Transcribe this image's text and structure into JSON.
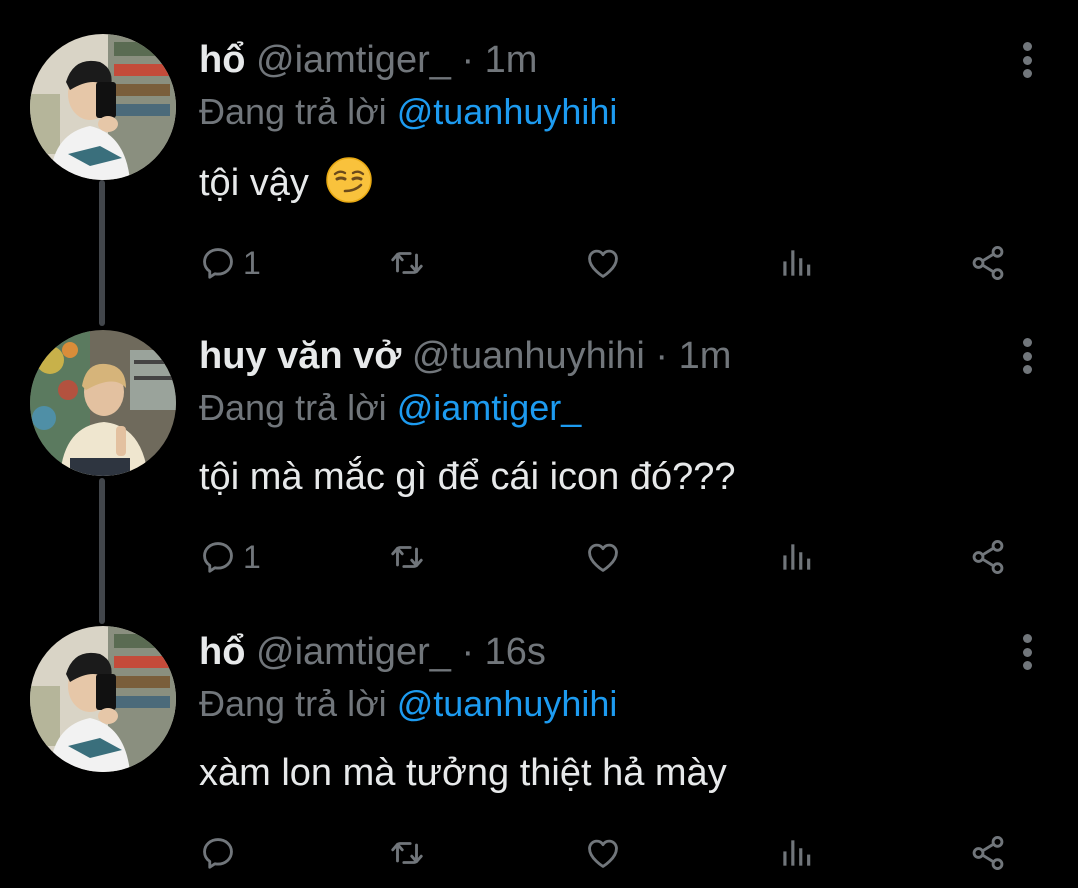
{
  "tweets": [
    {
      "name": "hổ",
      "handle": "@iamtiger_",
      "separator": "·",
      "time": "1m",
      "reply_prefix": "Đang trả lời",
      "reply_to": "@tuanhuyhihi",
      "text": "tội vậy",
      "emoji_icon": "smirking-face-emoji",
      "reply_count": "1",
      "retweet_count": "",
      "like_count": ""
    },
    {
      "name": "huy văn vở",
      "handle": "@tuanhuyhihi",
      "separator": "·",
      "time": "1m",
      "reply_prefix": "Đang trả lời",
      "reply_to": "@iamtiger_",
      "text": "tội mà mắc gì để cái icon đó???",
      "reply_count": "1",
      "retweet_count": "",
      "like_count": ""
    },
    {
      "name": "hổ",
      "handle": "@iamtiger_",
      "separator": "·",
      "time": "16s",
      "reply_prefix": "Đang trả lời",
      "reply_to": "@tuanhuyhihi",
      "text": "xàm lon mà tưởng thiệt hả mày",
      "reply_count": "",
      "retweet_count": "",
      "like_count": ""
    }
  ],
  "icons": {
    "reply": "reply-icon",
    "retweet": "retweet-icon",
    "like": "heart-icon",
    "views": "views-icon",
    "share": "share-icon",
    "more": "more-vertical-icon"
  },
  "colors": {
    "background": "#000000",
    "text": "#e7e9ea",
    "muted": "#71767b",
    "link": "#1d9bf0",
    "thread_line": "#42464b"
  }
}
